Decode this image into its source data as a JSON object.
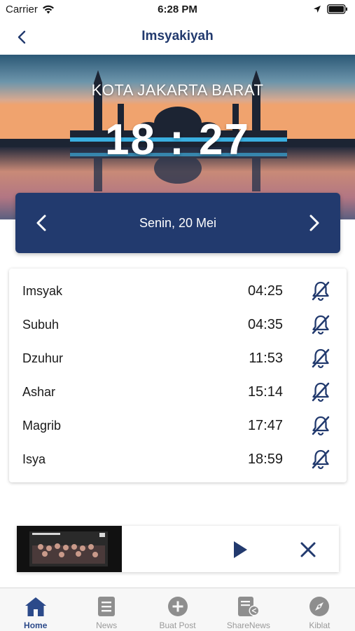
{
  "status_bar": {
    "carrier": "Carrier",
    "time": "6:28 PM"
  },
  "nav": {
    "title": "Imsyakiyah"
  },
  "hero": {
    "city": "KOTA JAKARTA BARAT",
    "clock": "18 : 27"
  },
  "date_bar": {
    "date": "Senin, 20 Mei"
  },
  "prayers": [
    {
      "name": "Imsyak",
      "time": "04:25",
      "alarm": "off"
    },
    {
      "name": "Subuh",
      "time": "04:35",
      "alarm": "off"
    },
    {
      "name": "Dzuhur",
      "time": "11:53",
      "alarm": "off"
    },
    {
      "name": "Ashar",
      "time": "15:14",
      "alarm": "off"
    },
    {
      "name": "Magrib",
      "time": "17:47",
      "alarm": "off"
    },
    {
      "name": "Isya",
      "time": "18:59",
      "alarm": "off"
    }
  ],
  "tabs": [
    {
      "label": "Home",
      "icon": "home-icon",
      "active": true
    },
    {
      "label": "News",
      "icon": "news-icon",
      "active": false
    },
    {
      "label": "Buat Post",
      "icon": "plus-circle-icon",
      "active": false
    },
    {
      "label": "ShareNews",
      "icon": "share-news-icon",
      "active": false
    },
    {
      "label": "Kiblat",
      "icon": "compass-icon",
      "active": false
    }
  ],
  "colors": {
    "primary": "#223a6e",
    "tab_active": "#2c4a8a",
    "tab_inactive": "#9a9a9a",
    "icon_grey": "#8e8e8e"
  }
}
